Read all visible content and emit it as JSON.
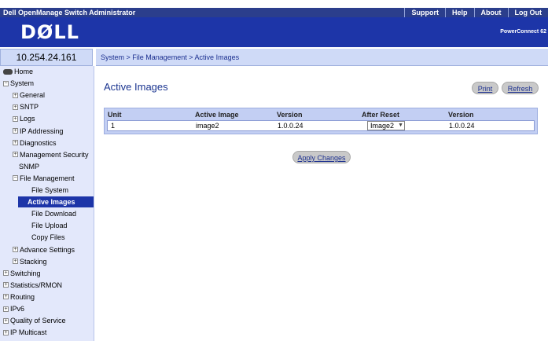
{
  "app": {
    "title": "Dell OpenManage Switch Administrator",
    "ip": "10.254.24.161",
    "logo": "DØLL",
    "model": "PowerConnect 62"
  },
  "topnav": [
    "Support",
    "Help",
    "About",
    "Log Out"
  ],
  "breadcrumb": "System > File Management > Active Images",
  "sidebar": [
    {
      "label": "Home",
      "level": 0,
      "type": "home"
    },
    {
      "label": "System",
      "level": 0,
      "type": "collapse"
    },
    {
      "label": "General",
      "level": 1,
      "type": "expand"
    },
    {
      "label": "SNTP",
      "level": 1,
      "type": "expand"
    },
    {
      "label": "Logs",
      "level": 1,
      "type": "expand"
    },
    {
      "label": "IP Addressing",
      "level": 1,
      "type": "expand"
    },
    {
      "label": "Diagnostics",
      "level": 1,
      "type": "expand"
    },
    {
      "label": "Management Security",
      "level": 1,
      "type": "expand"
    },
    {
      "label": "SNMP",
      "level": 1,
      "type": "leaf"
    },
    {
      "label": "File Management",
      "level": 1,
      "type": "collapse"
    },
    {
      "label": "File System",
      "level": 2,
      "type": "leaf"
    },
    {
      "label": "Active Images",
      "level": 2,
      "type": "leaf",
      "selected": true
    },
    {
      "label": "File Download",
      "level": 2,
      "type": "leaf"
    },
    {
      "label": "File Upload",
      "level": 2,
      "type": "leaf"
    },
    {
      "label": "Copy Files",
      "level": 2,
      "type": "leaf"
    },
    {
      "label": "Advance Settings",
      "level": 1,
      "type": "expand"
    },
    {
      "label": "Stacking",
      "level": 1,
      "type": "expand"
    },
    {
      "label": "Switching",
      "level": 0,
      "type": "expand"
    },
    {
      "label": "Statistics/RMON",
      "level": 0,
      "type": "expand"
    },
    {
      "label": "Routing",
      "level": 0,
      "type": "expand"
    },
    {
      "label": "IPv6",
      "level": 0,
      "type": "expand"
    },
    {
      "label": "Quality of Service",
      "level": 0,
      "type": "expand"
    },
    {
      "label": "IP Multicast",
      "level": 0,
      "type": "expand"
    }
  ],
  "main": {
    "title": "Active Images",
    "print_label": "Print",
    "refresh_label": "Refresh",
    "apply_label": "Apply Changes",
    "table": {
      "headers": [
        "Unit",
        "Active Image",
        "Version",
        "After Reset",
        "Version"
      ],
      "row": {
        "unit": "1",
        "active_image": "image2",
        "version": "1.0.0.24",
        "after_reset": "Image2",
        "version2": "1.0.0.24"
      }
    }
  }
}
